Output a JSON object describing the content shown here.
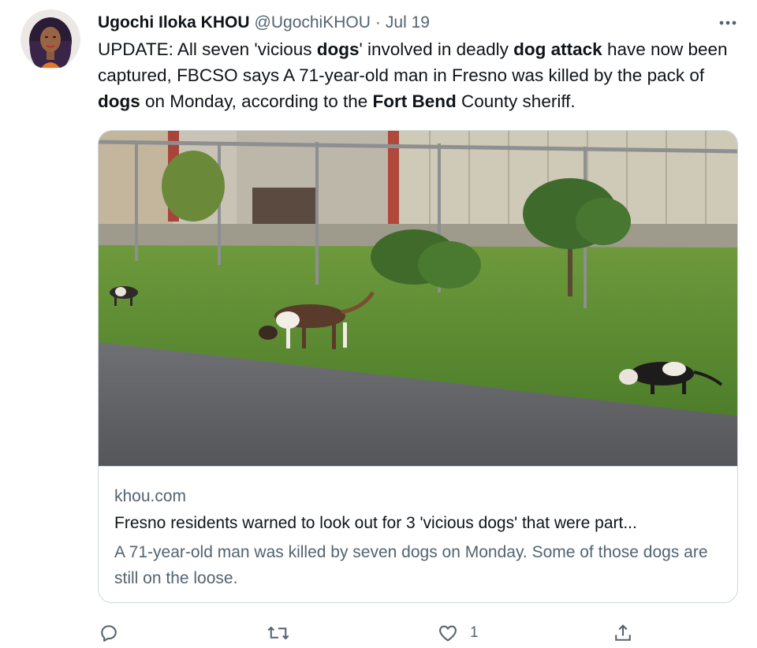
{
  "tweet": {
    "author_name": "Ugochi Iloka KHOU",
    "handle": "@UgochiKHOU",
    "separator": "·",
    "date": "Jul 19",
    "text_segments": [
      {
        "text": "UPDATE: All seven 'vicious ",
        "bold": false
      },
      {
        "text": "dogs",
        "bold": true
      },
      {
        "text": "' involved in deadly ",
        "bold": false
      },
      {
        "text": "dog attack",
        "bold": true
      },
      {
        "text": " have now been captured, FBCSO says A 71-year-old man in Fresno was killed by the pack of ",
        "bold": false
      },
      {
        "text": "dogs",
        "bold": true
      },
      {
        "text": " on Monday, according to the ",
        "bold": false
      },
      {
        "text": "Fort Bend",
        "bold": true
      },
      {
        "text": " County sheriff.",
        "bold": false
      }
    ]
  },
  "card": {
    "domain": "khou.com",
    "title": "Fresno residents warned to look out for 3 'vicious dogs' that were part...",
    "description": "A 71-year-old man was killed by seven dogs on Monday. Some of those dogs are still on the loose."
  },
  "actions": {
    "reply_icon": "reply-icon",
    "retweet_icon": "retweet-icon",
    "like_icon": "heart-icon",
    "like_count": "1",
    "share_icon": "share-icon"
  },
  "colors": {
    "text_primary": "#0f1419",
    "text_secondary": "#536471",
    "border": "#cfd9de"
  }
}
